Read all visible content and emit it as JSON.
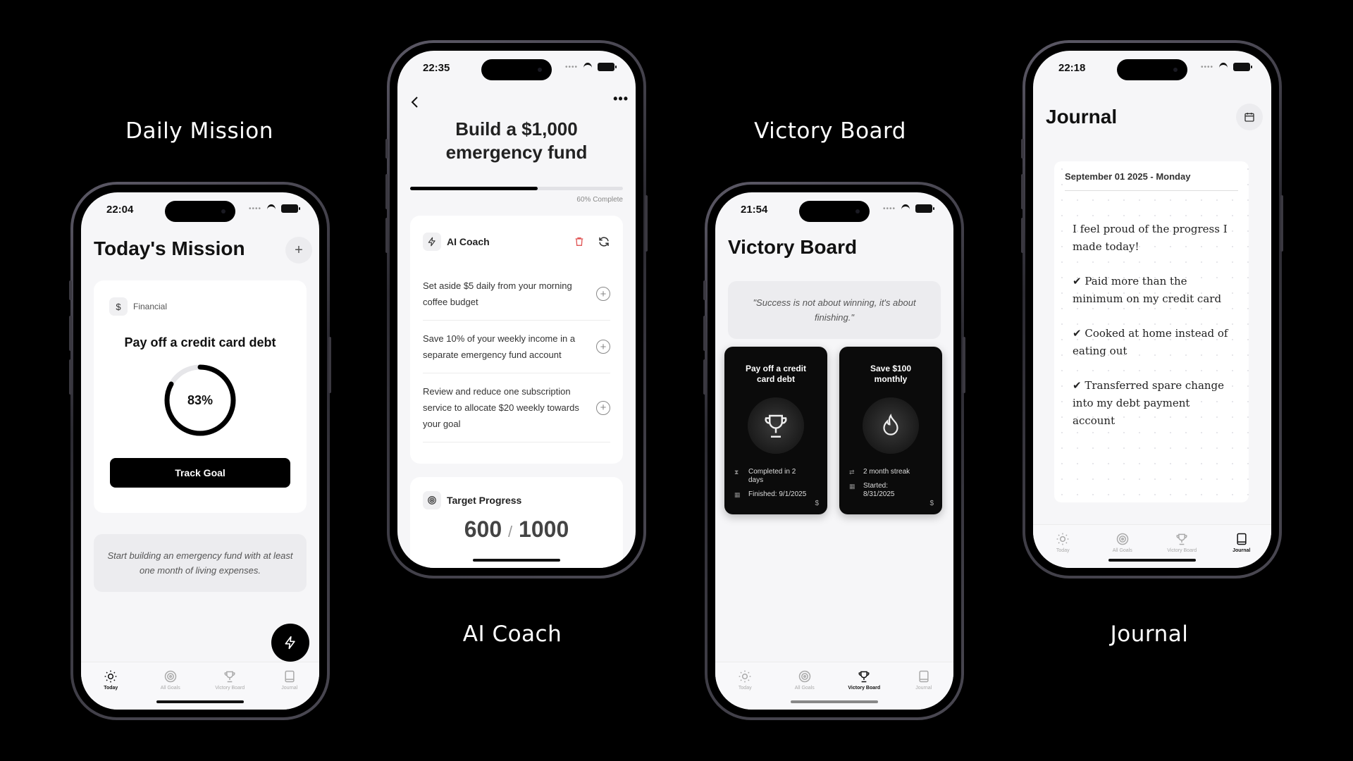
{
  "captions": {
    "daily": "Daily Mission",
    "coach": "AI Coach",
    "victory": "Victory Board",
    "journal": "Journal"
  },
  "tabs": [
    "Today",
    "All Goals",
    "Victory Board",
    "Journal"
  ],
  "phone1": {
    "time": "22:04",
    "title": "Today's Mission",
    "category": "Financial",
    "category_icon": "$",
    "goal_title": "Pay off a credit card debt",
    "progress_label": "83%",
    "progress": 0.83,
    "track_button": "Track Goal",
    "note": "Start building an emergency fund with at least one month of living expenses.",
    "active_tab": 0
  },
  "phone2": {
    "time": "22:35",
    "title": "Build a $1,000 emergency fund",
    "progress": 0.6,
    "progress_label": "60% Complete",
    "coach_title": "AI Coach",
    "suggestions": [
      "Set aside $5 daily from your morning coffee budget",
      "Save 10% of your weekly income in a separate emergency fund account",
      "Review and reduce one subscription service to allocate $20 weekly towards your goal"
    ],
    "target_title": "Target Progress",
    "target_current": "600",
    "target_sep": "/",
    "target_total": "1000"
  },
  "phone3": {
    "time": "21:54",
    "title": "Victory Board",
    "quote": "\"Success is not about winning, it's about finishing.\"",
    "cards": [
      {
        "title": "Pay off a credit card debt",
        "line1": "Completed in 2 days",
        "line2": "Finished: 9/1/2025",
        "icon": "trophy-icon"
      },
      {
        "title": "Save $100 monthly",
        "line1": "2 month streak",
        "line2": "Started: 8/31/2025",
        "icon": "flame-icon"
      }
    ],
    "currency": "$",
    "active_tab": 2
  },
  "phone4": {
    "time": "22:18",
    "title": "Journal",
    "date": "September 01 2025 - Monday",
    "entries": [
      "I feel proud of the progress I made today!",
      "✔ Paid more than the minimum on my credit card",
      "✔ Cooked at home instead of eating out",
      "✔ Transferred spare change into my debt payment account"
    ],
    "active_tab": 3
  },
  "colors": {
    "background": "#000000",
    "screen": "#f6f6f8",
    "accent": "#000000",
    "delete_red": "#e05555"
  }
}
